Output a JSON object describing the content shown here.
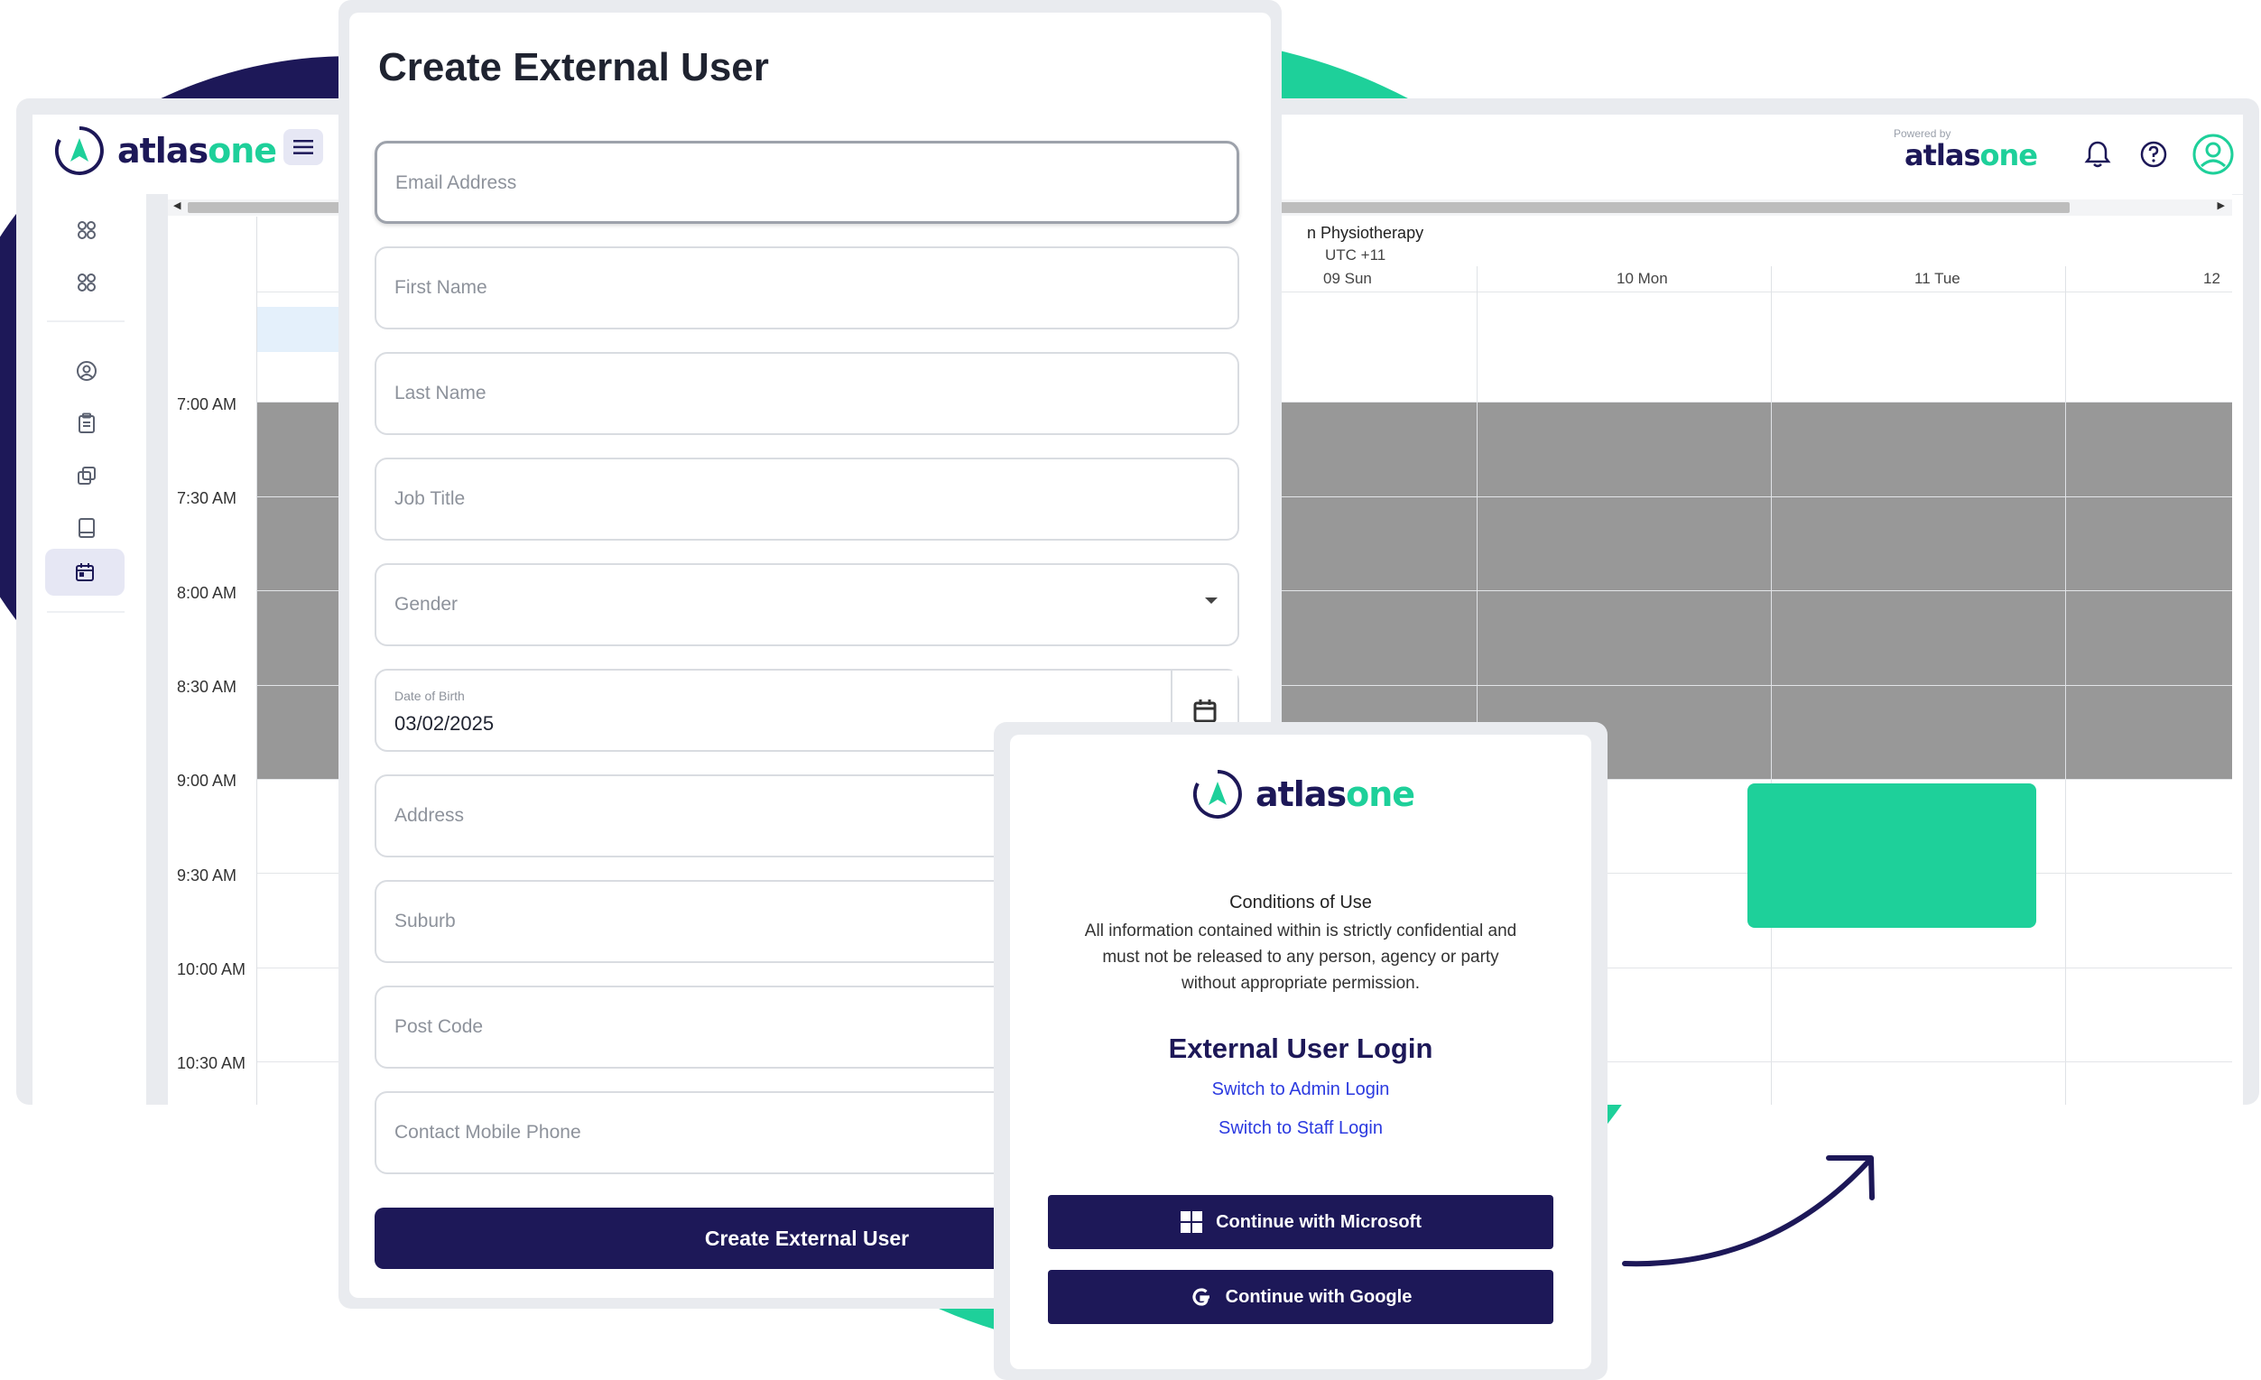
{
  "brand": {
    "logo_part1": "atlas",
    "logo_part2": "one",
    "powered_by": "Powered by"
  },
  "colors": {
    "navy": "#1d1858",
    "green": "#1ed09a",
    "blocked_slot": "#989898"
  },
  "app": {
    "top_icons": [
      "bell-icon",
      "help-icon",
      "user-icon"
    ],
    "sidebar_icons": [
      "apps-icon",
      "apps-icon",
      "user-circle-icon",
      "clipboard-icon",
      "copy-icon",
      "book-icon",
      "calendar-icon"
    ],
    "calendar": {
      "resource": "n Physiotherapy",
      "timezone": "UTC +11",
      "days": [
        "09 Sun",
        "10 Mon",
        "11 Tue",
        "12"
      ],
      "times": [
        "7:00 AM",
        "7:30 AM",
        "8:00 AM",
        "8:30 AM",
        "9:00 AM",
        "9:30 AM",
        "10:00 AM",
        "10:30 AM"
      ]
    }
  },
  "form": {
    "title": "Create External User",
    "fields": {
      "email": "Email Address",
      "first_name": "First Name",
      "last_name": "Last Name",
      "job_title": "Job Title",
      "gender": "Gender",
      "dob_label": "Date of Birth",
      "dob_value": "03/02/2025",
      "address": "Address",
      "suburb": "Suburb",
      "post_code": "Post Code",
      "mobile": "Contact Mobile Phone"
    },
    "submit_label": "Create External User"
  },
  "login": {
    "conditions_title": "Conditions of Use",
    "conditions_line1": "All information contained within is strictly confidential and",
    "conditions_line2": "must not be released to any person, agency or party",
    "conditions_line3": "without appropriate permission.",
    "title": "External User Login",
    "switch_admin": "Switch to Admin Login",
    "switch_staff": "Switch to Staff Login",
    "microsoft_label": "Continue with Microsoft",
    "google_label": "Continue with Google"
  }
}
